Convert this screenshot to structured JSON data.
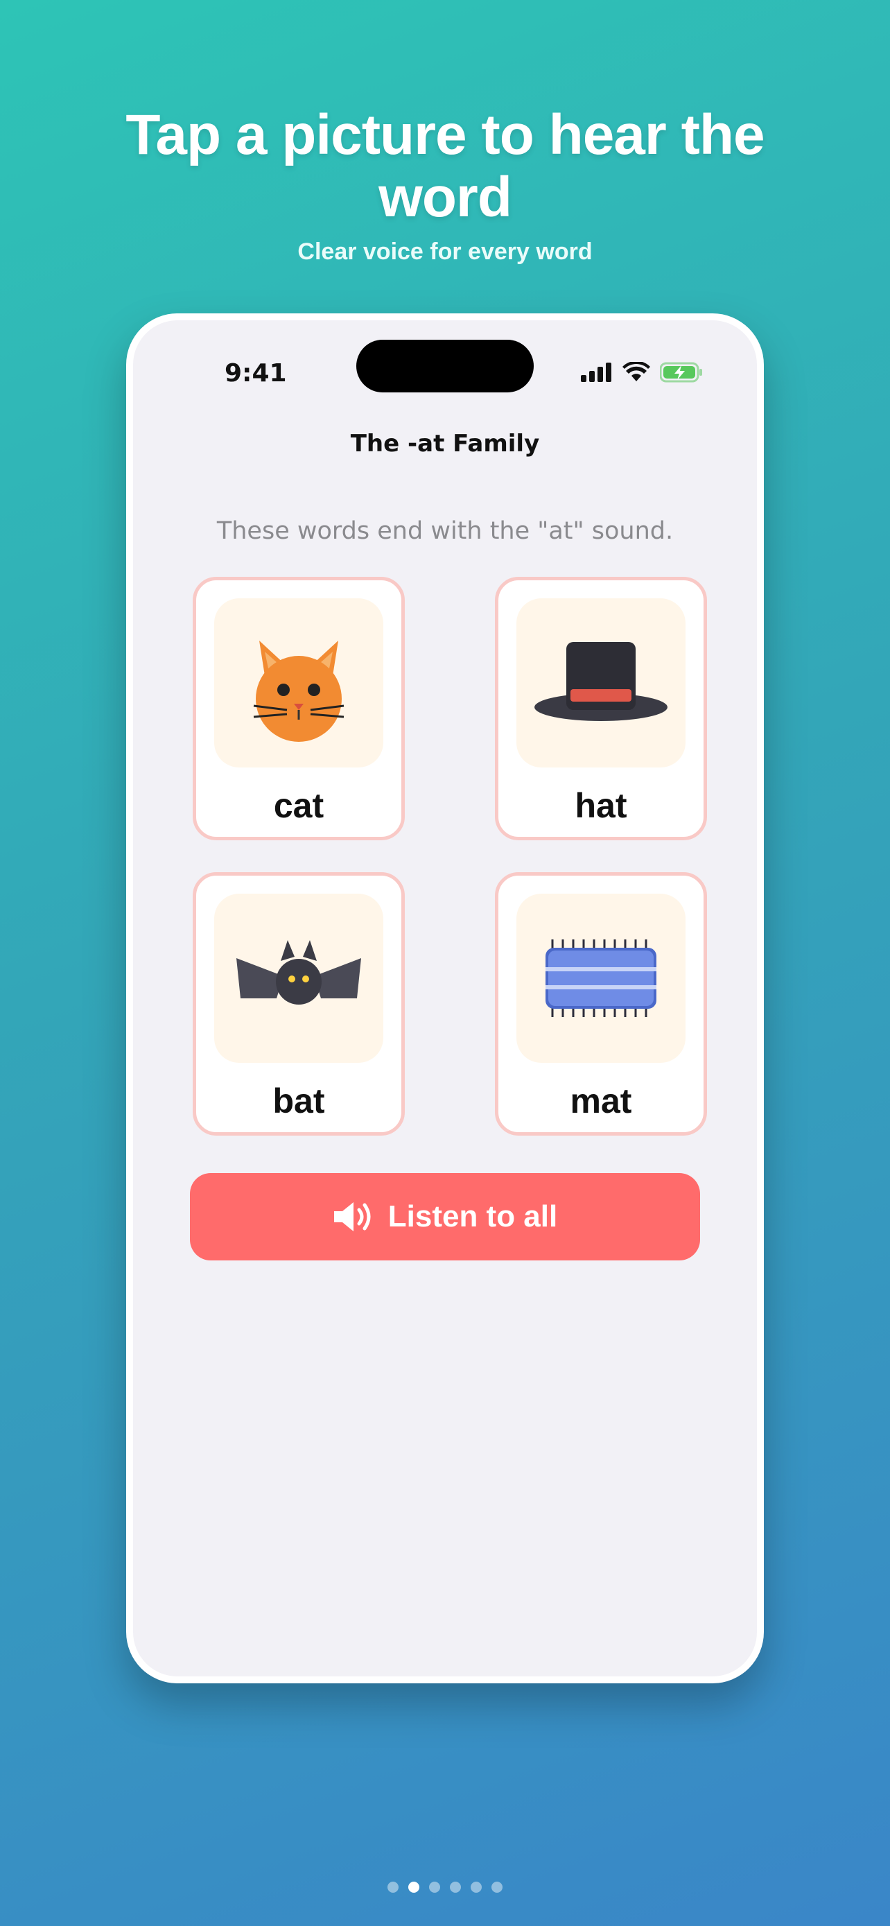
{
  "hero": {
    "title": "Tap a picture to hear the word",
    "subtitle": "Clear voice for every word"
  },
  "status_bar": {
    "time": "9:41",
    "icons": [
      "cellular-signal-icon",
      "wifi-icon",
      "battery-charging-icon"
    ]
  },
  "screen": {
    "nav_title": "The -at Family",
    "instruction": "These words end with the \"at\" sound.",
    "cards": [
      {
        "word": "cat",
        "icon": "cat-face-icon"
      },
      {
        "word": "hat",
        "icon": "top-hat-icon"
      },
      {
        "word": "bat",
        "icon": "bat-icon"
      },
      {
        "word": "mat",
        "icon": "mat-icon"
      }
    ],
    "listen_button": {
      "label": "Listen to all",
      "icon": "speaker-icon"
    }
  },
  "pagination": {
    "total": 6,
    "active_index": 1
  },
  "colors": {
    "background_top": "#2ec4b6",
    "background_bottom": "#3a86c8",
    "card_border": "#f9c9c6",
    "card_art_bg": "#fff6e9",
    "button": "#ff6b6b",
    "screen_bg": "#f2f1f6"
  }
}
